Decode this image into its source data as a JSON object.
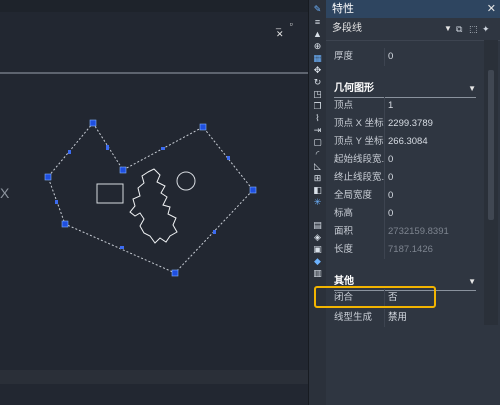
{
  "viewport": {
    "controls": "_ ▫ ✕"
  },
  "drawing": {
    "axis_marker": "X"
  },
  "panel": {
    "title": "特性",
    "selector": {
      "value": "多段线"
    },
    "rows_top": [
      {
        "key": "厚度",
        "value": "0"
      }
    ],
    "sections": {
      "geometry": "几何图形",
      "other": "其他"
    },
    "geometry_rows": [
      {
        "key": "顶点",
        "value": "1"
      },
      {
        "key": "顶点 X 坐标",
        "value": "2299.3789"
      },
      {
        "key": "顶点 Y 坐标",
        "value": "266.3084"
      },
      {
        "key": "起始线段宽...",
        "value": "0"
      },
      {
        "key": "终止线段宽...",
        "value": "0"
      },
      {
        "key": "全局宽度",
        "value": "0"
      },
      {
        "key": "标高",
        "value": "0"
      },
      {
        "key": "面积",
        "value": "2732159.8391"
      },
      {
        "key": "长度",
        "value": "7187.1426"
      }
    ],
    "other_rows": [
      {
        "key": "闭合",
        "value": "否"
      },
      {
        "key": "线型生成",
        "value": "禁用"
      }
    ]
  },
  "colors": {
    "highlight": "#f2b400",
    "grip": "#1f4fe0",
    "header": "#2e4560"
  }
}
